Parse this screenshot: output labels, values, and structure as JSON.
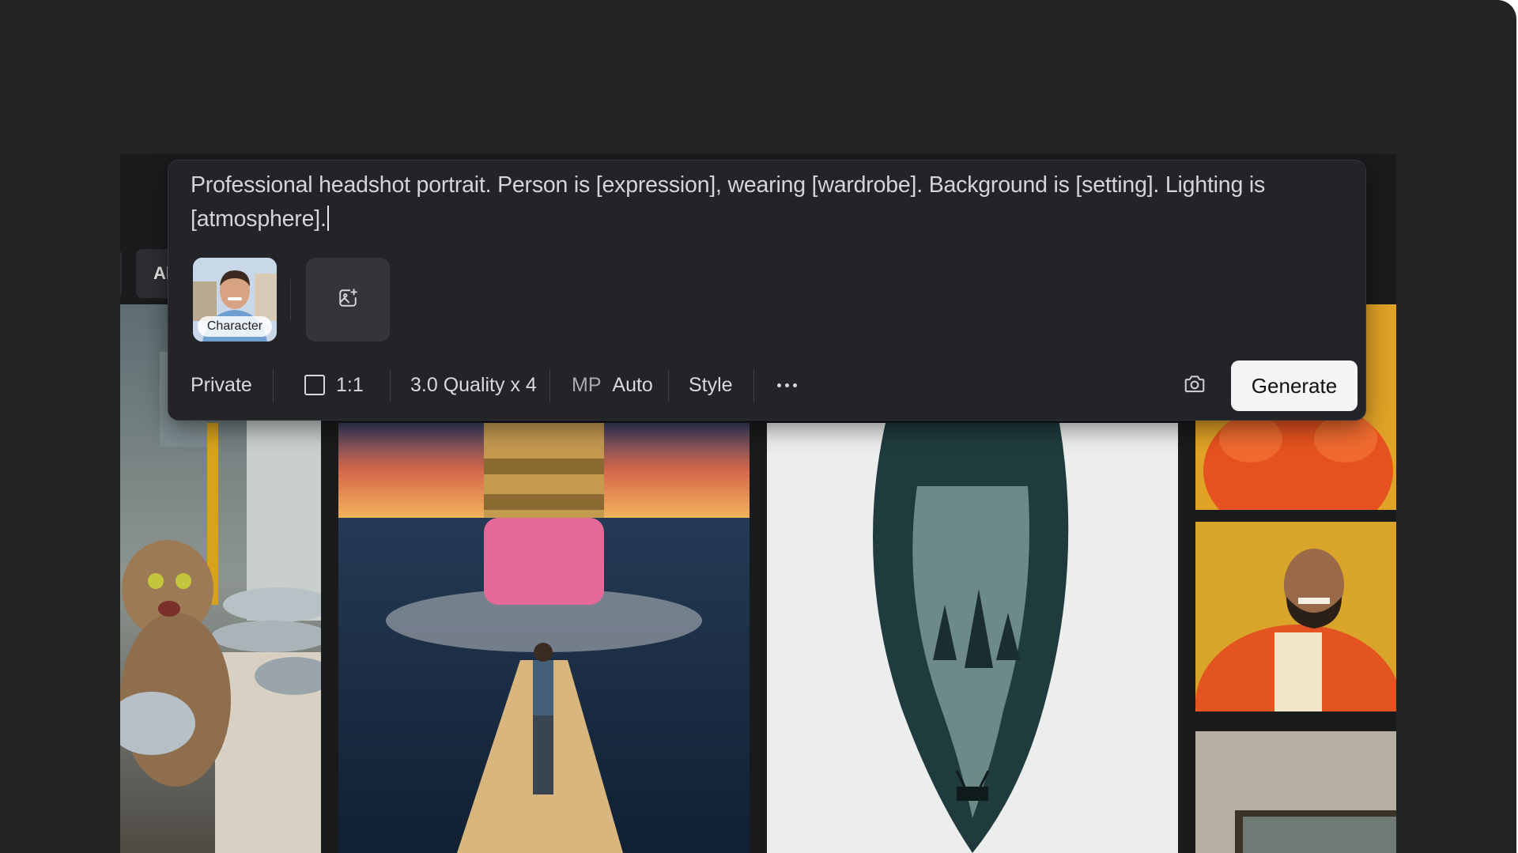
{
  "prompt": {
    "text": "Professional headshot portrait. Person is [expression], wearing [wardrobe]. Background is [setting]. Lighting is [atmosphere]."
  },
  "filter_chip": {
    "label": "Al"
  },
  "reference": {
    "character_label": "Character"
  },
  "toolbar": {
    "visibility": "Private",
    "aspect_ratio": "1:1",
    "quality": "3.0 Quality x 4",
    "mp_label": "MP",
    "mp_value": "Auto",
    "style": "Style",
    "generate": "Generate"
  },
  "icons": {
    "add_image": "image-plus-icon",
    "camera": "camera-icon",
    "more": "more-horizontal-icon",
    "aspect": "square-aspect-icon"
  },
  "colors": {
    "background": "#232426",
    "panel": "#232427",
    "generate_button": "#f4f4f5"
  }
}
